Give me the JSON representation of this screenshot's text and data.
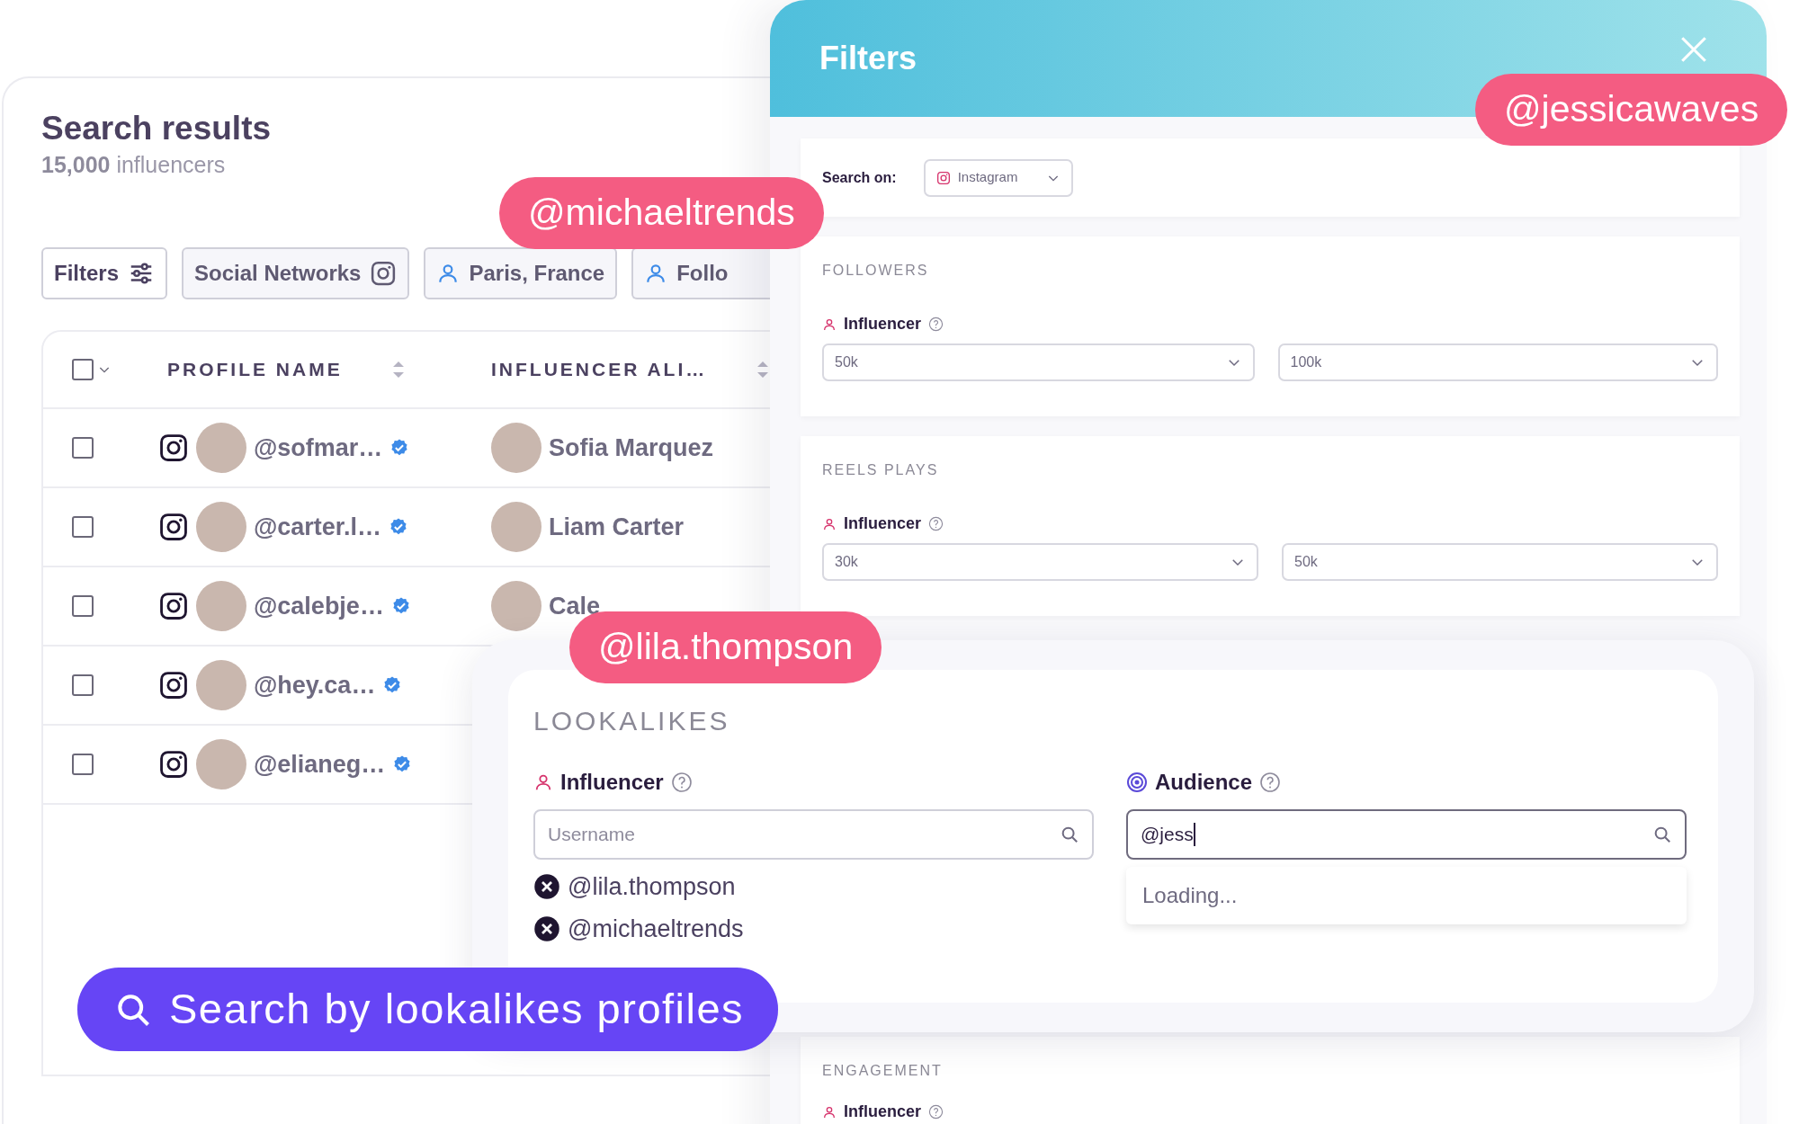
{
  "results": {
    "title": "Search results",
    "count": "15,000",
    "count_label": "influencers",
    "chips": [
      {
        "label": "Filters",
        "kind": "filters"
      },
      {
        "label": "Social Networks",
        "kind": "network"
      },
      {
        "label": "Paris, France",
        "kind": "person"
      },
      {
        "label": "Follo",
        "kind": "person"
      }
    ],
    "table": {
      "columns": [
        "PROFILE NAME",
        "INFLUENCER ALI…"
      ],
      "header_checked": false,
      "rows": [
        {
          "checked": false,
          "handle": "@sofmar…",
          "verified": true,
          "alias": "Sofia Marquez"
        },
        {
          "checked": false,
          "handle": "@carter.l…",
          "verified": true,
          "alias": "Liam Carter"
        },
        {
          "checked": false,
          "handle": "@calebje…",
          "verified": true,
          "alias": "Cale"
        },
        {
          "checked": false,
          "handle": "@hey.ca…",
          "verified": true
        },
        {
          "checked": false,
          "handle": "@elianeg…",
          "verified": true
        }
      ]
    }
  },
  "filters": {
    "title": "Filters",
    "search_on": {
      "label": "Search on:",
      "value": "Instagram"
    },
    "sections": [
      {
        "title": "FOLLOWERS",
        "label": "Influencer",
        "min": "50k",
        "max": "100k"
      },
      {
        "title": "REELS PLAYS",
        "label": "Influencer",
        "min": "30k",
        "max": "50k"
      },
      {
        "title": "ENGAGEMENT",
        "label": "Influencer"
      }
    ]
  },
  "lookalikes": {
    "title": "LOOKALIKES",
    "influencer": {
      "label": "Influencer",
      "placeholder": "Username",
      "selected": [
        "@lila.thompson",
        "@michaeltrends"
      ]
    },
    "audience": {
      "label": "Audience",
      "value": "@jess",
      "dropdown": "Loading..."
    }
  },
  "tags": [
    "@michaeltrends",
    "@jessicawaves",
    "@lila.thompson"
  ],
  "banner": {
    "text": "Search by lookalikes profiles"
  }
}
